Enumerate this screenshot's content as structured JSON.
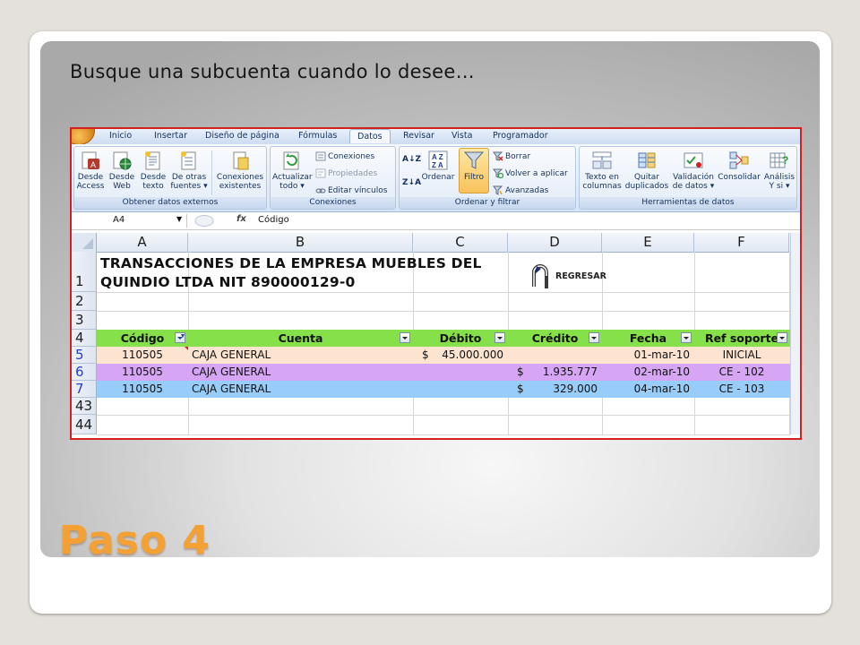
{
  "slide": {
    "title": "Busque una subcuenta cuando lo desee…",
    "step": "Paso 4"
  },
  "ribbon": {
    "tabs": [
      "Inicio",
      "Insertar",
      "Diseño de página",
      "Fórmulas",
      "Datos",
      "Revisar",
      "Vista",
      "Programador"
    ],
    "active_tab": "Datos",
    "groups": {
      "external": {
        "label": "Obtener datos externos",
        "buttons": [
          {
            "line1": "Desde",
            "line2": "Access"
          },
          {
            "line1": "Desde",
            "line2": "Web"
          },
          {
            "line1": "Desde",
            "line2": "texto"
          },
          {
            "line1": "De otras",
            "line2": "fuentes ▾"
          },
          {
            "line1": "Conexiones",
            "line2": "existentes"
          }
        ]
      },
      "connections": {
        "label": "Conexiones",
        "refresh": {
          "line1": "Actualizar",
          "line2": "todo ▾"
        },
        "items": [
          "Conexiones",
          "Propiedades",
          "Editar vínculos"
        ]
      },
      "sort_filter": {
        "label": "Ordenar y filtrar",
        "sort": "Ordenar",
        "filter": "Filtro",
        "items": [
          "Borrar",
          "Volver a aplicar",
          "Avanzadas"
        ]
      },
      "data_tools": {
        "label": "Herramientas de datos",
        "buttons": [
          {
            "line1": "Texto en",
            "line2": "columnas"
          },
          {
            "line1": "Quitar",
            "line2": "duplicados"
          },
          {
            "line1": "Validación",
            "line2": "de datos ▾"
          },
          {
            "line1": "Consolidar",
            "line2": ""
          },
          {
            "line1": "Análisis",
            "line2": "Y si ▾"
          }
        ]
      }
    }
  },
  "formula_bar": {
    "name_box": "A4",
    "fx": "fx",
    "value": "Código"
  },
  "sheet": {
    "columns": [
      "A",
      "B",
      "C",
      "D",
      "E",
      "F"
    ],
    "row_numbers": [
      "1",
      "2",
      "3",
      "4",
      "5",
      "6",
      "7",
      "43",
      "44"
    ],
    "title_line1": "TRANSACCIONES DE LA EMPRESA MUEBLES DEL",
    "title_line2": "QUINDIO LTDA NIT 890000129-0",
    "back_label": "REGRESAR",
    "headers": [
      "Código",
      "Cuenta",
      "Débito",
      "Crédito",
      "Fecha",
      "Ref soporte"
    ],
    "rows": [
      {
        "codigo": "110505",
        "cuenta": "CAJA GENERAL",
        "debito_sym": "$",
        "debito": "45.000.000",
        "credito_sym": "",
        "credito": "",
        "fecha": "01-mar-10",
        "ref": "INICIAL",
        "color": "#fce4d0"
      },
      {
        "codigo": "110505",
        "cuenta": "CAJA GENERAL",
        "debito_sym": "",
        "debito": "",
        "credito_sym": "$",
        "credito": "1.935.777",
        "fecha": "02-mar-10",
        "ref": "CE - 102",
        "color": "#d6a6f5"
      },
      {
        "codigo": "110505",
        "cuenta": "CAJA GENERAL",
        "debito_sym": "",
        "debito": "",
        "credito_sym": "$",
        "credito": "329.000",
        "fecha": "04-mar-10",
        "ref": "CE - 103",
        "color": "#97cdf8"
      }
    ],
    "header_color": "#86e04a"
  }
}
